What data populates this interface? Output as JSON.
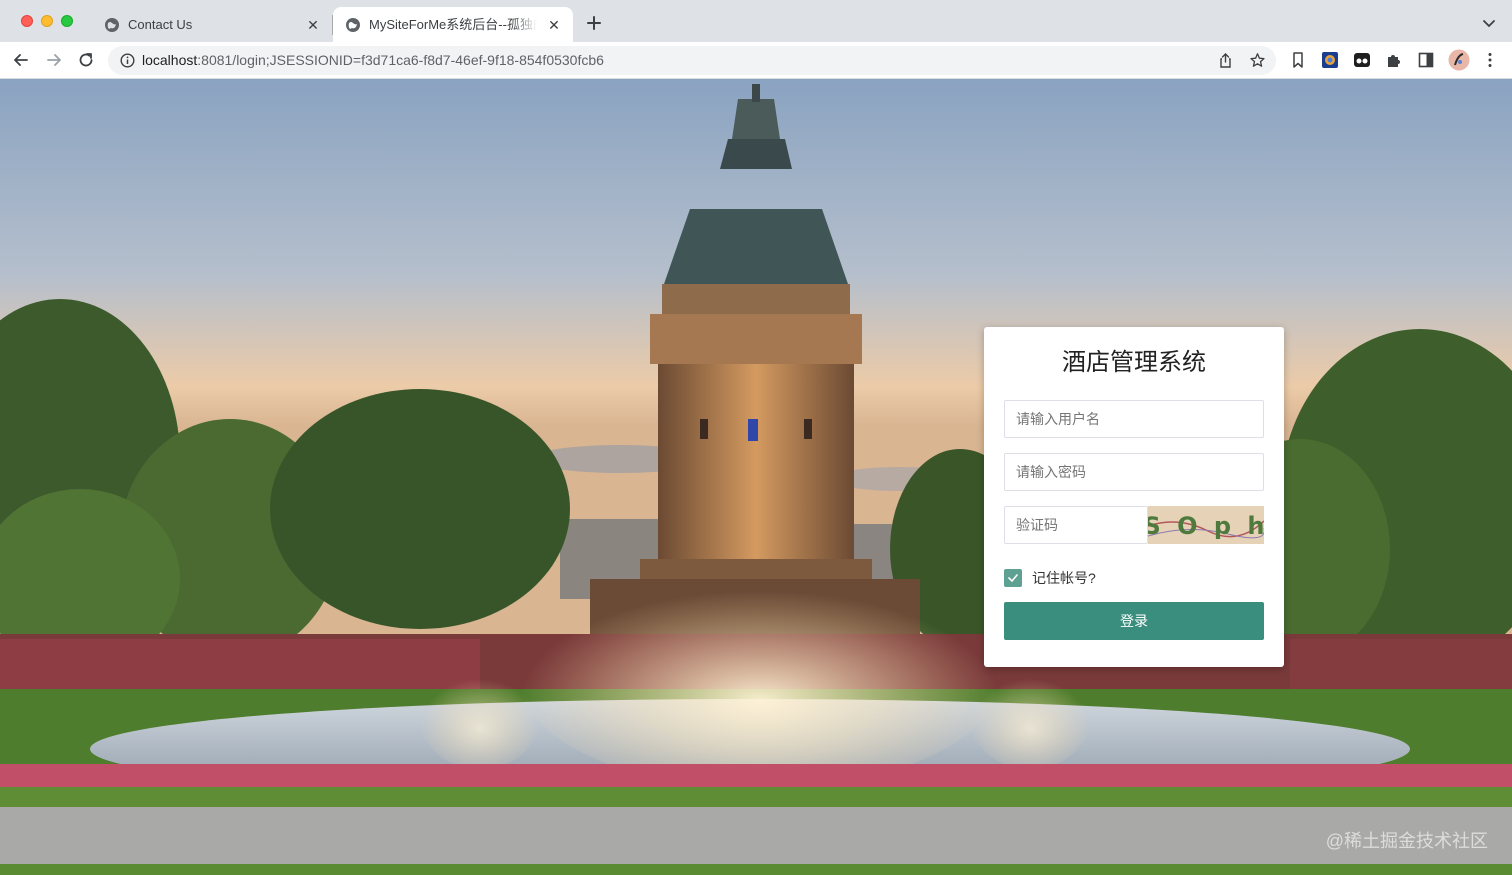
{
  "browser": {
    "tabs": [
      {
        "title": "Contact Us",
        "active": false
      },
      {
        "title": "MySiteForMe系统后台--孤独的飞猪",
        "active": true
      }
    ],
    "address": {
      "host": "localhost",
      "path": ":8081/login;JSESSIONID=f3d71ca6-f8d7-46ef-9f18-854f0530fcb6"
    },
    "icons": [
      "back-icon",
      "forward-icon",
      "reload-icon",
      "info-icon",
      "share-icon",
      "star-icon",
      "bookmark-icon",
      "extension-icon",
      "puzzle-icon",
      "sidebar-icon",
      "profile-avatar",
      "menu-icon"
    ]
  },
  "login": {
    "title": "酒店管理系统",
    "username_placeholder": "请输入用户名",
    "password_placeholder": "请输入密码",
    "captcha_placeholder": "验证码",
    "captcha_text": "S O p h",
    "remember_label": "记住帐号?",
    "remember_checked": true,
    "submit_label": "登录"
  },
  "watermark": "@稀土掘金技术社区",
  "colors": {
    "primary": "#3a8e7d",
    "checkbox": "#43907f"
  }
}
